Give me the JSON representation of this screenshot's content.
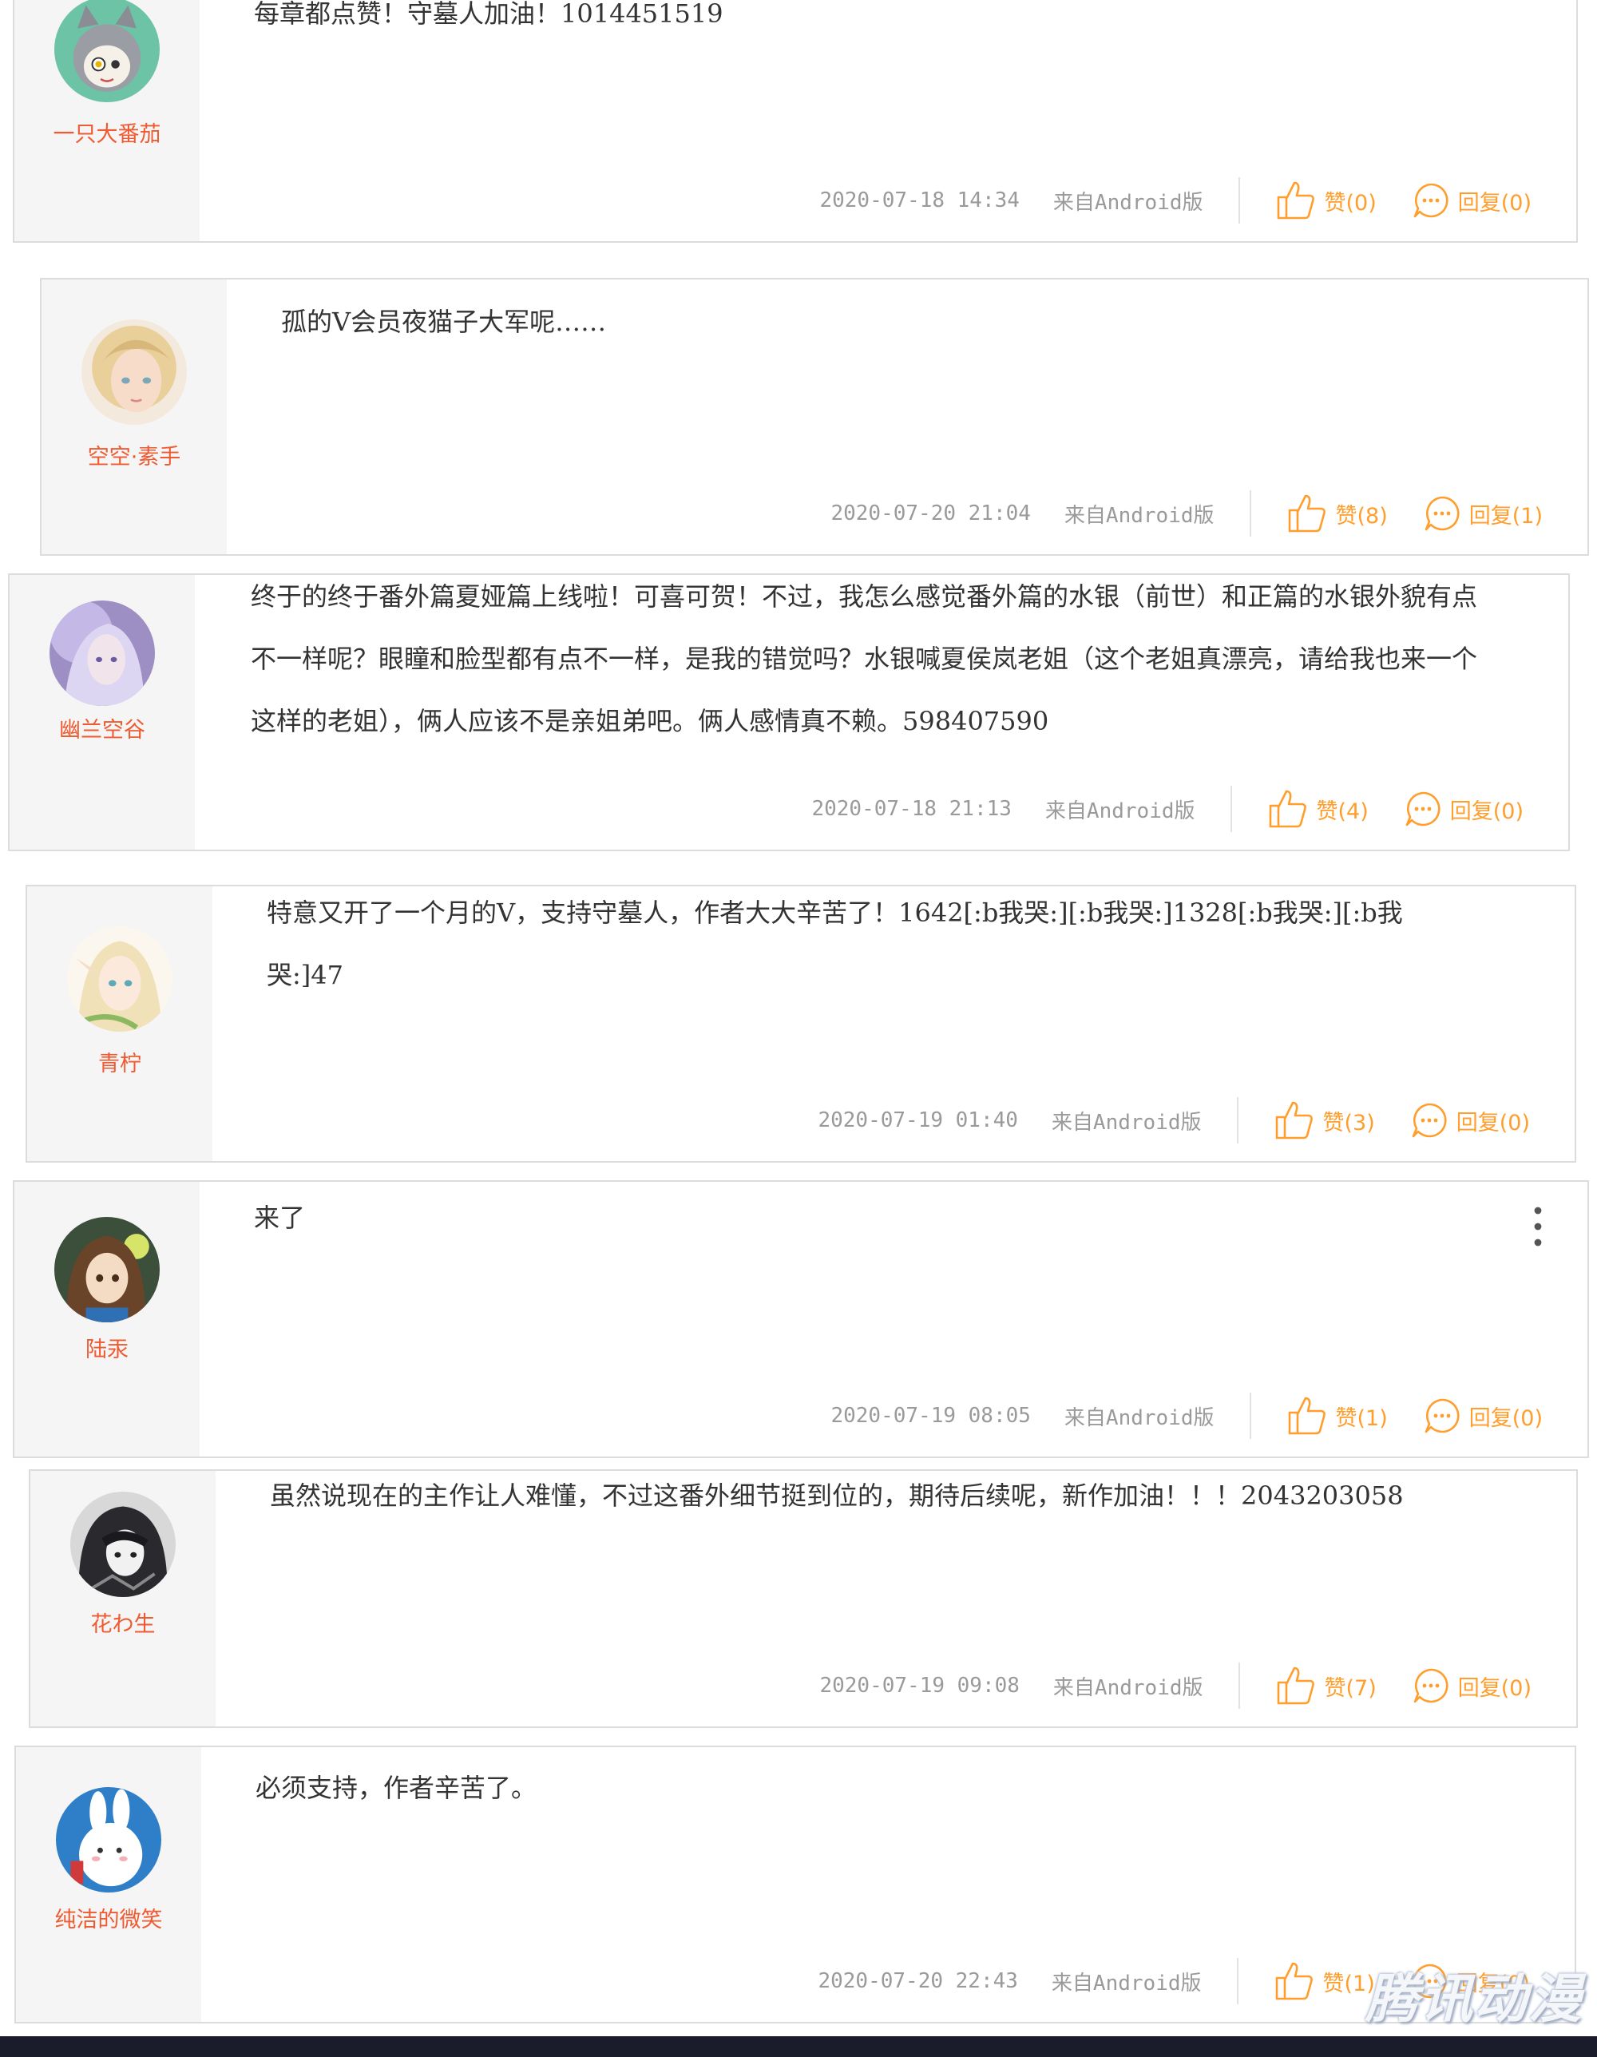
{
  "comments": [
    {
      "username": "一只大番茄",
      "content": "每章都点赞！守墓人加油！1014451519",
      "date": "2020-07-18 14:34",
      "source": "来自Android版",
      "like_label": "赞(0)",
      "reply_label": "回复(0)",
      "avatar_icon": "avatar-cat-girl"
    },
    {
      "username": "空空·素手",
      "content": "孤的V会员夜猫子大军呢……",
      "date": "2020-07-20 21:04",
      "source": "来自Android版",
      "like_label": "赞(8)",
      "reply_label": "回复(1)",
      "avatar_icon": "avatar-blonde-girl"
    },
    {
      "username": "幽兰空谷",
      "content": "终于的终于番外篇夏娅篇上线啦！可喜可贺！不过，我怎么感觉番外篇的水银（前世）和正篇的水银外貌有点不一样呢？眼瞳和脸型都有点不一样，是我的错觉吗？水银喊夏侯岚老姐（这个老姐真漂亮，请给我也来一个这样的老姐），俩人应该不是亲姐弟吧。俩人感情真不赖。598407590",
      "date": "2020-07-18 21:13",
      "source": "来自Android版",
      "like_label": "赞(4)",
      "reply_label": "回复(0)",
      "avatar_icon": "avatar-purple-girl"
    },
    {
      "username": "青柠",
      "content": "特意又开了一个月的V，支持守墓人，作者大大辛苦了！1642[:b我哭:][:b我哭:]1328[:b我哭:][:b我哭:]47",
      "date": "2020-07-19 01:40",
      "source": "来自Android版",
      "like_label": "赞(3)",
      "reply_label": "回复(0)",
      "avatar_icon": "avatar-elf-girl"
    },
    {
      "username": "陆汞",
      "content": "来了",
      "date": "2020-07-19 08:05",
      "source": "来自Android版",
      "like_label": "赞(1)",
      "reply_label": "回复(0)",
      "avatar_icon": "avatar-brown-hair",
      "more_icon": "more-vertical-icon"
    },
    {
      "username": "花わ生",
      "content": "虽然说现在的主作让人难懂，不过这番外细节挺到位的，期待后续呢，新作加油！！！2043203058",
      "date": "2020-07-19 09:08",
      "source": "来自Android版",
      "like_label": "赞(7)",
      "reply_label": "回复(0)",
      "avatar_icon": "avatar-dark-boy"
    },
    {
      "username": "纯洁的微笑",
      "content": "必须支持，作者辛苦了。",
      "date": "2020-07-20 22:43",
      "source": "来自Android版",
      "like_label": "赞(1)",
      "reply_label": "回复(0)",
      "avatar_icon": "avatar-white-rabbit"
    }
  ],
  "icons": {
    "like": "thumbs-up-icon",
    "reply": "reply-bubble-icon"
  },
  "colors": {
    "username": "#f05a30",
    "action": "#ff9e2c",
    "meta": "#9a9a9a",
    "border": "#dcdcdc",
    "sidebar": "#f5f5f5",
    "bottom_bar": "#1a1c2c"
  },
  "watermark": "腾讯动漫"
}
